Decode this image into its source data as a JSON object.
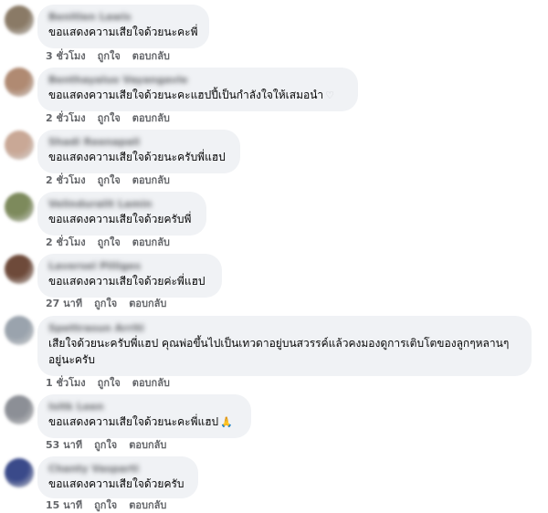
{
  "comments": [
    {
      "author": "Benitlen Lawis",
      "text": "ขอแสดงความเสียใจด้วยนะคะพี่",
      "emoji": "",
      "time": "3 ชั่วโมง",
      "like": "ถูกใจ",
      "reply": "ตอบกลับ",
      "avatar_color": "#8a7a66"
    },
    {
      "author": "Benthayaluo Vayangavle",
      "text": "ขอแสดงความเสียใจด้วยนะคะแฮปปี้เป็นกำลังใจให้เสมอนำ",
      "emoji": "♡",
      "time": "2 ชั่วโมง",
      "like": "ถูกใจ",
      "reply": "ตอบกลับ",
      "avatar_color": "#b08a72"
    },
    {
      "author": "Shadi Reenapali",
      "text": "ขอแสดงความเสียใจด้วยนะครับพี่แฮป",
      "emoji": "",
      "time": "2 ชั่วโมง",
      "like": "ถูกใจ",
      "reply": "ตอบกลับ",
      "avatar_color": "#c9a896"
    },
    {
      "author": "Velinduralit Lamin",
      "text": "ขอแสดงความเสียใจด้วยครับพี่",
      "emoji": "",
      "time": "2 ชั่วโมง",
      "like": "ถูกใจ",
      "reply": "ตอบกลับ",
      "avatar_color": "#7d8a5c"
    },
    {
      "author": "Laversel Pilliges",
      "text": "ขอแสดงความเสียใจด้วยค่ะพี่แฮป",
      "emoji": "",
      "time": "27 นาที",
      "like": "ถูกใจ",
      "reply": "ตอบกลับ",
      "avatar_color": "#6e4a3a"
    },
    {
      "author": "Spettrasun Arriti",
      "text": "เสียใจด้วยนะครับพี่แฮป คุณพ่อขึ้นไปเป็นเทวดาอยู่บนสวรรค์แล้วคงมองดูการเติบโตของลูกๆหลานๆอยู่นะครับ",
      "emoji": "",
      "time": "1 ชั่วโมง",
      "like": "ถูกใจ",
      "reply": "ตอบกลับ",
      "avatar_color": "#9aa3ad"
    },
    {
      "author": "Isitk Leen",
      "text": "ขอแสดงความเสียใจด้วยนะคะพี่แฮป",
      "emoji": "🙏",
      "time": "53 นาที",
      "like": "ถูกใจ",
      "reply": "ตอบกลับ",
      "avatar_color": "#8c8f96"
    },
    {
      "author": "Chanty Vasparti",
      "text": "ขอแสดงความเสียใจด้วยครับ",
      "emoji": "",
      "time": "15 นาที",
      "like": "ถูกใจ",
      "reply": "ตอบกลับ",
      "avatar_color": "#3a4a8a"
    }
  ]
}
